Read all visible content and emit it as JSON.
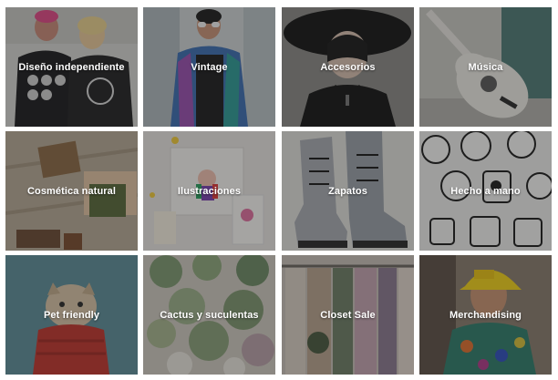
{
  "categories": [
    {
      "label": "Diseño independiente",
      "color": "#2a2a2e"
    },
    {
      "label": "Vintage",
      "color": "#6e7e8c"
    },
    {
      "label": "Accesorios",
      "color": "#2b2b2b"
    },
    {
      "label": "Música",
      "color": "#b9b9b3"
    },
    {
      "label": "Cosmética natural",
      "color": "#8c7a63"
    },
    {
      "label": "Ilustraciones",
      "color": "#e9e7e4"
    },
    {
      "label": "Zapatos",
      "color": "#9a9ea4"
    },
    {
      "label": "Hecho a mano",
      "color": "#d3d6d8"
    },
    {
      "label": "Pet friendly",
      "color": "#4d7d88"
    },
    {
      "label": "Cactus y suculentas",
      "color": "#b7b2a9"
    },
    {
      "label": "Closet Sale",
      "color": "#9b8f86"
    },
    {
      "label": "Merchandising",
      "color": "#6b5a4c"
    }
  ]
}
